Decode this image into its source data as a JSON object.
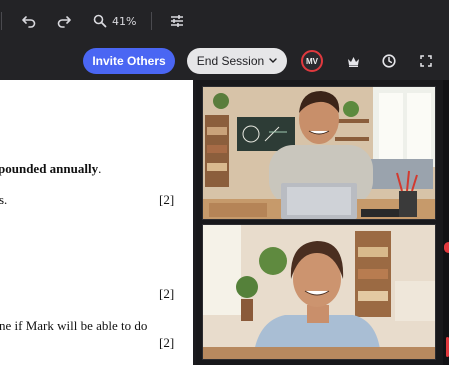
{
  "toolbar": {
    "zoom_label": "41%",
    "icons": [
      "undo-icon",
      "redo-icon",
      "zoom-icon",
      "settings-sliders-icon"
    ]
  },
  "header": {
    "invite_label": "Invite Others",
    "end_session_label": "End Session",
    "avatar_initials": "MV",
    "icons": [
      "crown-icon",
      "clock-icon",
      "fullscreen-icon"
    ]
  },
  "document": {
    "lines": [
      {
        "text": "pounded annually",
        "bold": true,
        "suffix": "."
      },
      {
        "text": "s."
      },
      {
        "text": "ne if Mark will be able to do"
      }
    ],
    "marks": [
      "[2]",
      "[2]",
      "[2]"
    ]
  },
  "colors": {
    "accent": "#4a66f3",
    "danger": "#e0393e",
    "toolbar_bg": "#232326"
  }
}
